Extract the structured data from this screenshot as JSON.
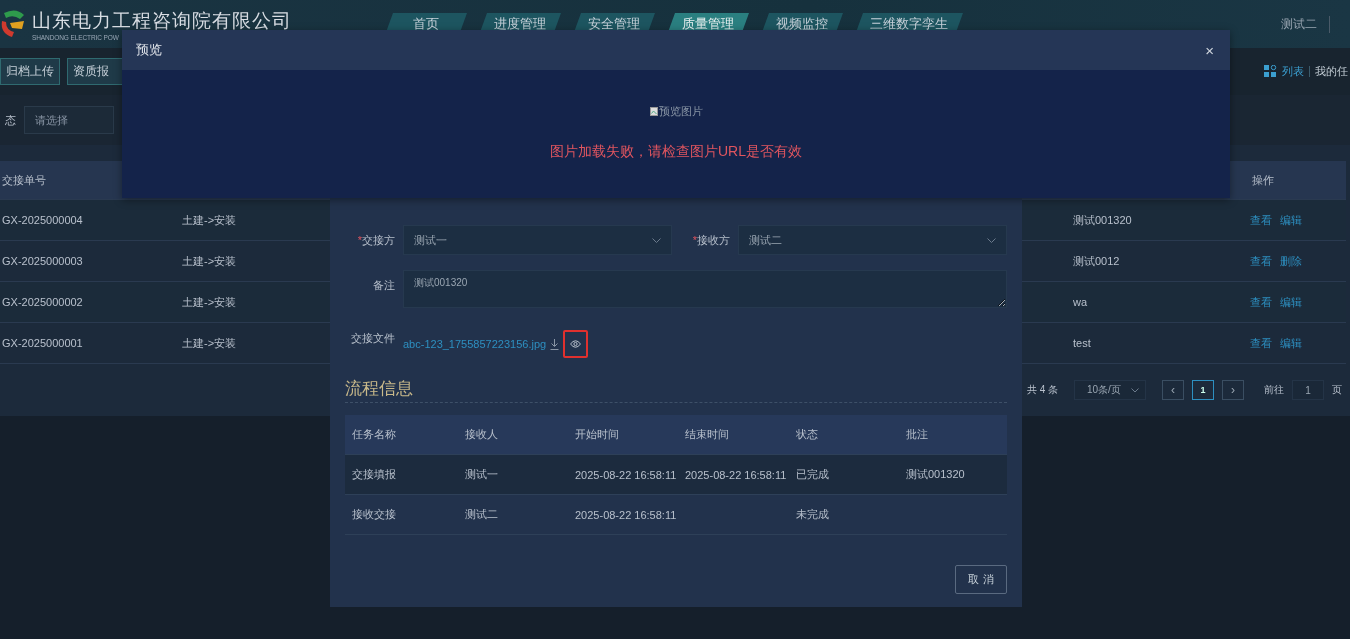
{
  "header": {
    "company": "山东电力工程咨询院有限公司",
    "subtitle": "SHANDONG ELECTRIC POW",
    "user": "测试二"
  },
  "nav": [
    {
      "label": "首页",
      "selected": false
    },
    {
      "label": "进度管理",
      "selected": false
    },
    {
      "label": "安全管理",
      "selected": false
    },
    {
      "label": "质量管理",
      "selected": true
    },
    {
      "label": "视频监控",
      "selected": false
    },
    {
      "label": "三维数字孪生",
      "selected": false
    }
  ],
  "toolbar": {
    "buttons": [
      "归档上传",
      "资质报"
    ],
    "view_link": "列表",
    "task_link": "我的任"
  },
  "filter": {
    "label": "态",
    "placeholder": "请选择"
  },
  "table": {
    "columns": [
      "交接单号",
      "操作"
    ],
    "rows": [
      {
        "code": "GX-2025000004",
        "type": "土建->安装",
        "column_3": "测试001320",
        "actions": [
          "查看",
          "编辑"
        ]
      },
      {
        "code": "GX-2025000003",
        "type": "土建->安装",
        "column_3": "测试0012",
        "actions": [
          "查看",
          "删除"
        ]
      },
      {
        "code": "GX-2025000002",
        "type": "土建->安装",
        "column_3": "wa",
        "actions": [
          "查看",
          "编辑"
        ]
      },
      {
        "code": "GX-2025000001",
        "type": "土建->安装",
        "column_3": "test",
        "actions": [
          "查看",
          "编辑"
        ]
      }
    ]
  },
  "pagination": {
    "total": "共 4 条",
    "page_size": "10条/页",
    "prev": "‹",
    "pages": [
      {
        "label": "1",
        "selected": true
      }
    ],
    "next": "›",
    "goto_label": "前往",
    "goto_value": "1",
    "goto_suffix": "页"
  },
  "detail_dialog": {
    "fields": [
      {
        "kind": "select",
        "mark": "*",
        "label": "交接方",
        "value": "测试一"
      },
      {
        "kind": "select",
        "mark": "*",
        "label": "接收方",
        "value": "测试二"
      },
      {
        "kind": "textarea",
        "label": "备注",
        "value": "测试001320"
      }
    ],
    "file": {
      "label": "交接文件",
      "name": "abc-123_1755857223156.jpg"
    },
    "section_title": "流程信息",
    "process_table": {
      "columns": [
        "任务名称",
        "接收人",
        "开始时间",
        "结束时间",
        "状态",
        "批注"
      ],
      "rows": [
        [
          "交接填报",
          "测试一",
          "2025-08-22 16:58:11",
          "2025-08-22 16:58:11",
          "已完成",
          "测试001320"
        ],
        [
          "接收交接",
          "测试二",
          "2025-08-22 16:58:11",
          "",
          "未完成",
          ""
        ]
      ]
    },
    "cancel": "取 消"
  },
  "preview_dialog": {
    "title": "预览",
    "close": "×",
    "image_alt": "预览图片",
    "error": "图片加载失败，请检查图片URL是否有效"
  }
}
